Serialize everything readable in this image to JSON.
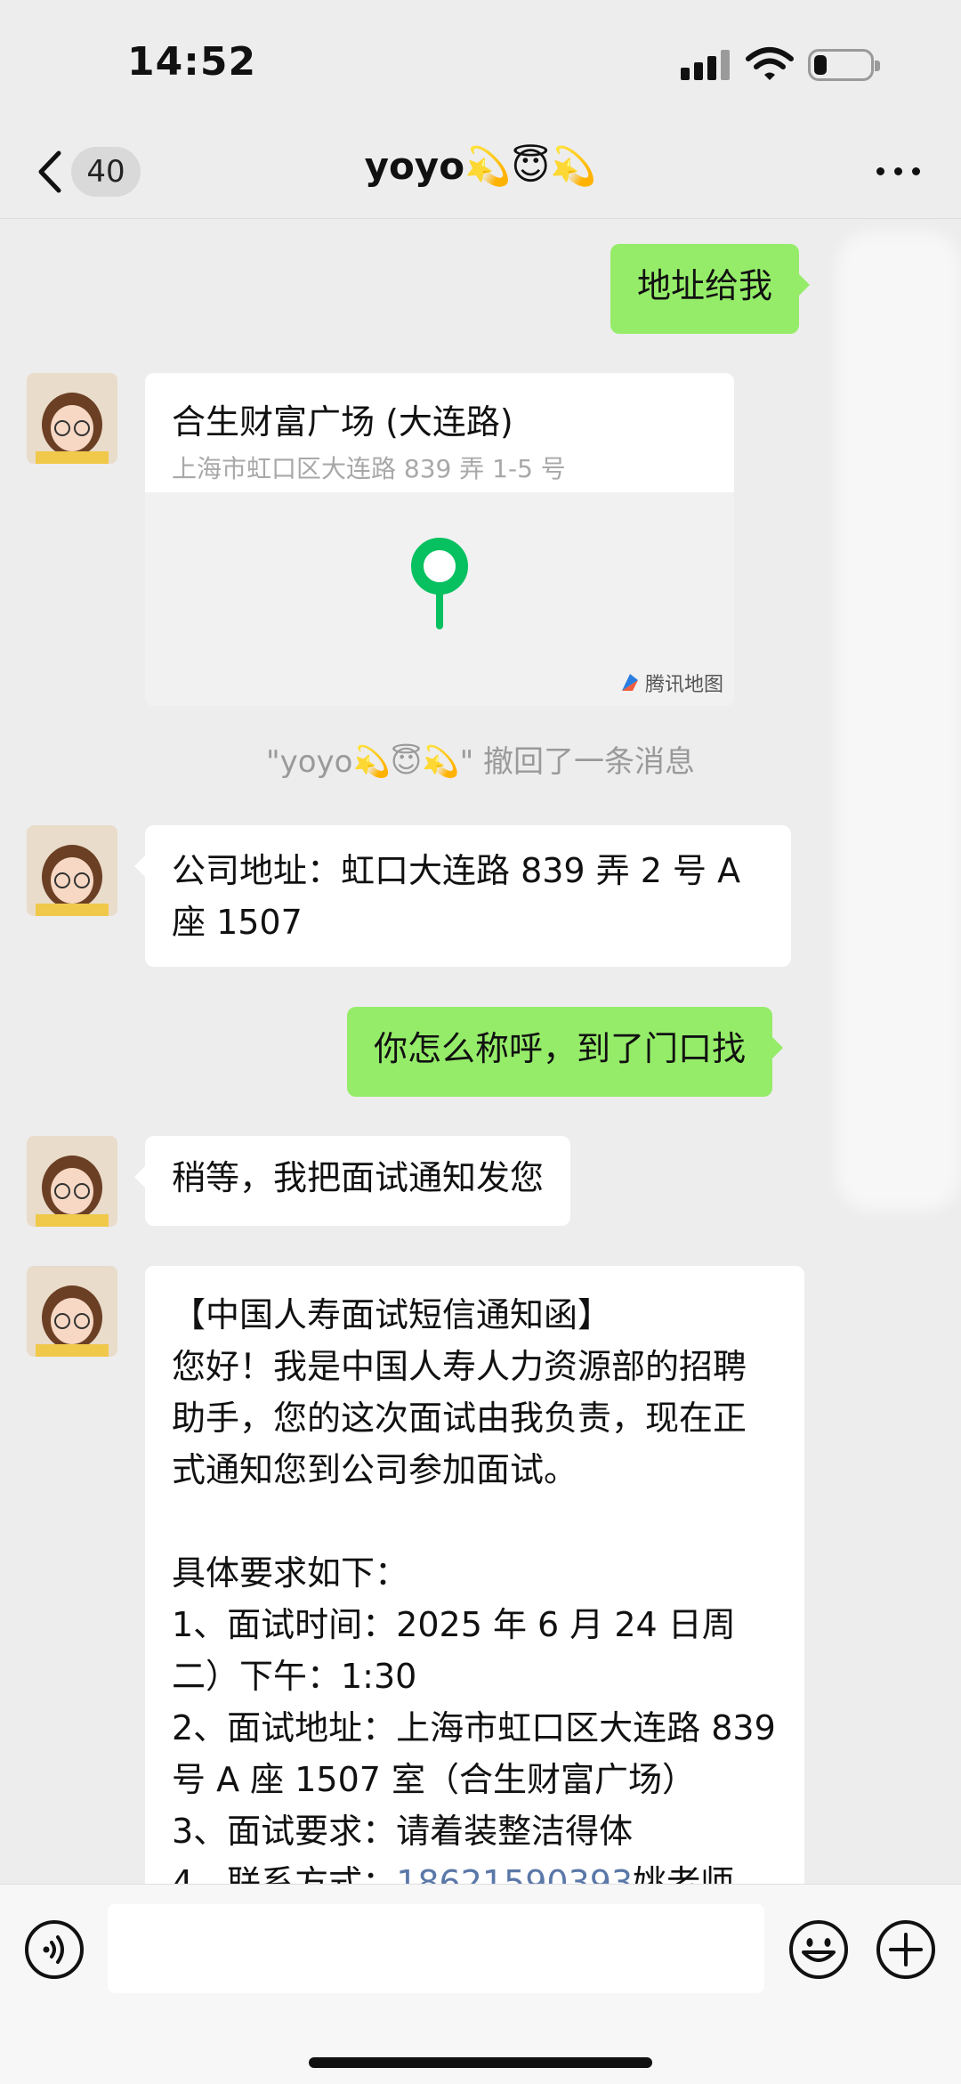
{
  "status_bar": {
    "time": "14:52"
  },
  "nav": {
    "unread_count": "40",
    "title": "yoyo💫😇💫"
  },
  "messages": {
    "m1_text": "地址给我",
    "location": {
      "name": "合生财富广场 (大连路)",
      "address": "上海市虹口区大连路 839 弄 1-5 号",
      "provider": "腾讯地图"
    },
    "recall_notice": "\"yoyo💫😇💫\" 撤回了一条消息",
    "m3_text": "公司地址：虹口大连路 839 弄 2 号 A 座 1507",
    "m4_text": "你怎么称呼，到了门口找",
    "m5_text": "稍等，我把面试通知发您",
    "m6_before_link": "【中国人寿面试短信通知函】\n您好！我是中国人寿人力资源部的招聘助手，您的这次面试由我负责，现在正式通知您到公司参加面试。\n\n具体要求如下：\n1、面试时间：2025 年 6 月 24 日周二）下午：1:30\n2、面试地址：上海市虹口区大连路 839 号 A 座 1507 室（合生财富广场）\n3、面试要求：请着装整洁得体\n4、联系方式：",
    "m6_link": "18621590393",
    "m6_after_link": "姚老师"
  },
  "input_bar": {
    "placeholder": ""
  },
  "colors": {
    "outgoing_bubble": "#95ec69",
    "incoming_bubble": "#ffffff",
    "background": "#ededed",
    "link": "#5a78a8",
    "pin": "#07c160"
  }
}
